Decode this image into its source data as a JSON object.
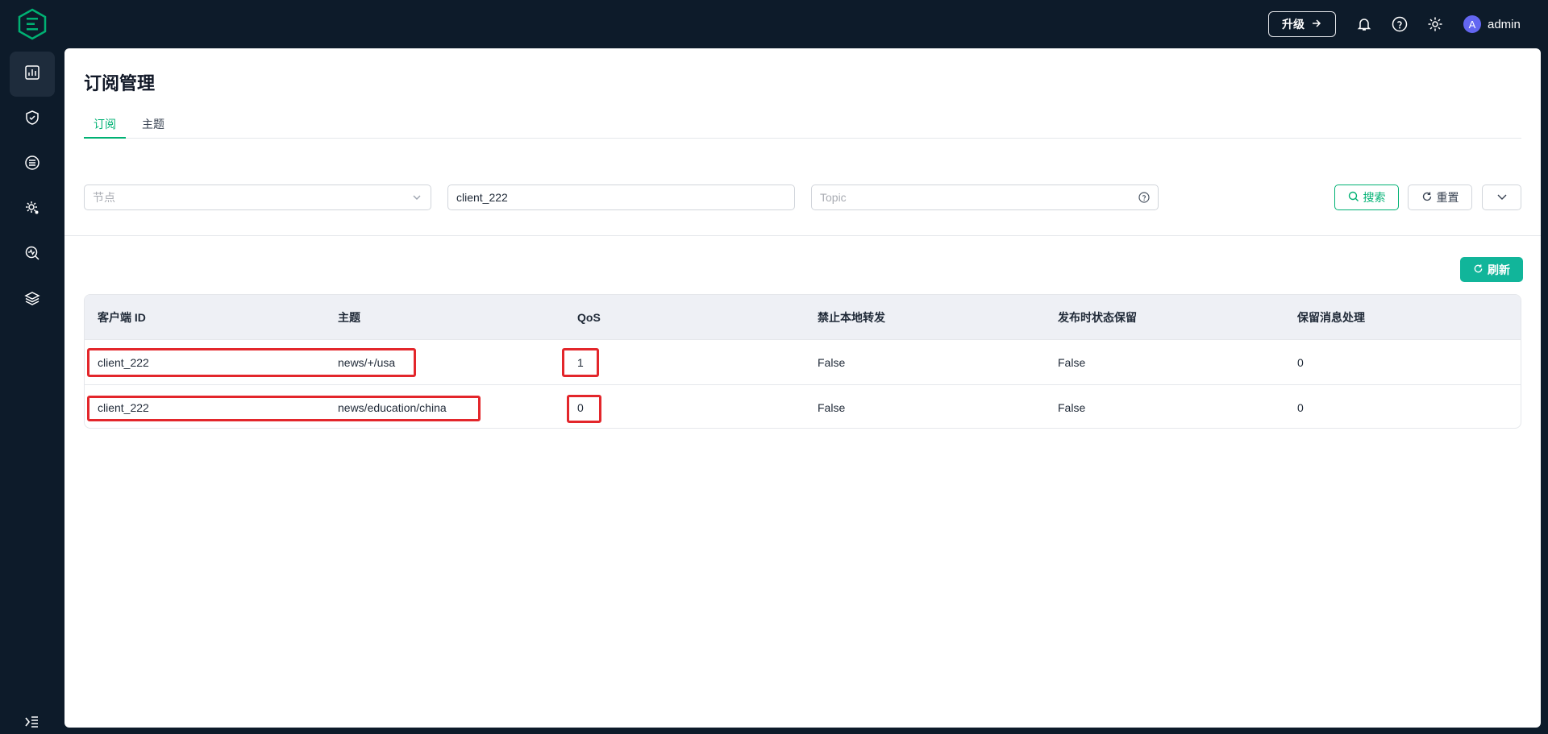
{
  "header": {
    "upgrade_label": "升级",
    "user_name": "admin",
    "avatar_initial": "A"
  },
  "page": {
    "title": "订阅管理",
    "tabs": [
      {
        "label": "订阅",
        "active": true
      },
      {
        "label": "主题",
        "active": false
      }
    ]
  },
  "filters": {
    "node_placeholder": "节点",
    "client_value": "client_222",
    "topic_placeholder": "Topic",
    "search_label": "搜索",
    "reset_label": "重置"
  },
  "refresh_label": "刷新",
  "table": {
    "columns": [
      "客户端 ID",
      "主题",
      "QoS",
      "禁止本地转发",
      "发布时状态保留",
      "保留消息处理"
    ],
    "rows": [
      {
        "client_id": "client_222",
        "topic": "news/+/usa",
        "qos": "1",
        "nl": "False",
        "rap": "False",
        "rh": "0"
      },
      {
        "client_id": "client_222",
        "topic": "news/education/china",
        "qos": "0",
        "nl": "False",
        "rap": "False",
        "rh": "0"
      }
    ]
  },
  "colors": {
    "accent": "#00b173",
    "refresh_button": "#11b59a",
    "highlight": "#e3262b",
    "sidebar_bg": "#0d1b2a",
    "avatar": "#6366f1"
  },
  "icons": {
    "logo": "emqx-logo",
    "nav": [
      "dashboard-icon",
      "shield-icon",
      "integration-icon",
      "gear-management-icon",
      "diagnose-icon",
      "layers-icon"
    ],
    "top": [
      "bell-icon",
      "help-icon",
      "settings-icon"
    ]
  }
}
